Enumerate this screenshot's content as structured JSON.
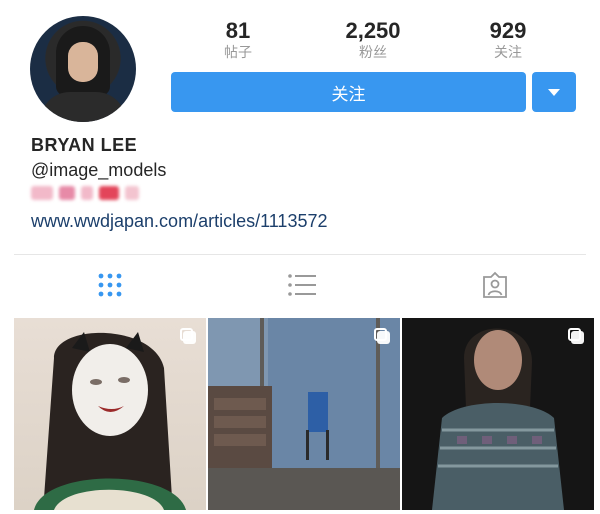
{
  "profile": {
    "name": "BRYAN LEE",
    "handle": "@image_models",
    "link": "www.wwdjapan.com/articles/1113572"
  },
  "stats": [
    {
      "value": "81",
      "label": "帖子"
    },
    {
      "value": "2,250",
      "label": "粉丝"
    },
    {
      "value": "929",
      "label": "关注"
    }
  ],
  "actions": {
    "follow_label": "关注"
  },
  "tabs": [
    {
      "name": "grid",
      "icon": "grid-icon",
      "active": true
    },
    {
      "name": "list",
      "icon": "list-icon",
      "active": false
    },
    {
      "name": "tagged",
      "icon": "tagged-person-icon",
      "active": false
    }
  ],
  "colors": {
    "accent": "#3897f0",
    "link": "#1c3f6b",
    "active_tab": "#3897f0",
    "inactive_tab": "#999999"
  },
  "posts": [
    {
      "icon": "multi-photo-icon"
    },
    {
      "icon": "multi-photo-icon"
    },
    {
      "icon": "multi-photo-icon"
    }
  ]
}
